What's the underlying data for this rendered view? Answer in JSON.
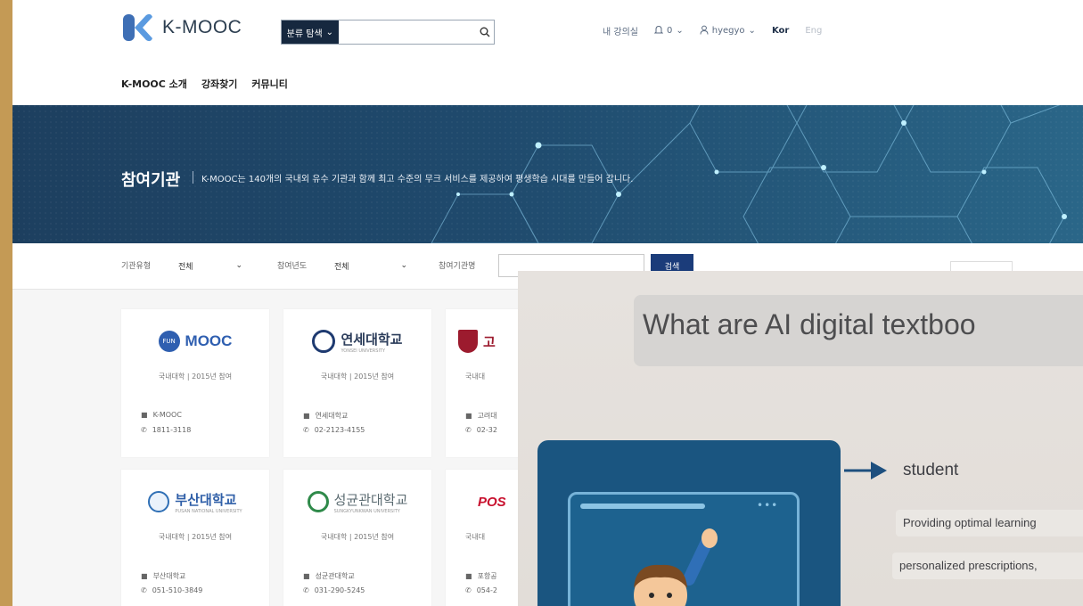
{
  "header": {
    "logo_text": "K-MOOC",
    "search": {
      "category_label": "분류 탐색",
      "placeholder": ""
    },
    "util": {
      "my_lecture": "내 강의실",
      "notifications": "0",
      "username": "hyegyo",
      "lang_kor": "Kor",
      "lang_eng": "Eng"
    }
  },
  "nav": [
    "K-MOOC 소개",
    "강좌찾기",
    "커뮤니티"
  ],
  "banner": {
    "title": "참여기관",
    "description": "K-MOOC는 140개의 국내외 유수 기관과 함께 최고 수준의 무크 서비스를 제공하여 평생학습 시대를 만들어 갑니다."
  },
  "filter": {
    "type_label": "기관유형",
    "type_value": "전체",
    "year_label": "참여년도",
    "year_value": "전체",
    "name_label": "참여기관명",
    "search_button": "검색"
  },
  "cards": [
    {
      "logo": "MOOC",
      "meta": "국내대학 | 2015년 참여",
      "name": "K-MOOC",
      "phone": "1811-3118"
    },
    {
      "logo": "연세대학교",
      "logo_sub": "YONSEI UNIVERSITY",
      "meta": "국내대학 | 2015년 참여",
      "name": "연세대학교",
      "phone": "02-2123-4155"
    },
    {
      "logo": "고",
      "meta": "국내대",
      "name": "고려대",
      "phone": "02-32"
    },
    {
      "logo": "부산대학교",
      "logo_sub": "PUSAN NATIONAL UNIVERSITY",
      "meta": "국내대학 | 2015년 참여",
      "name": "부산대학교",
      "phone": "051-510-3849"
    },
    {
      "logo": "성균관대학교",
      "logo_sub": "SUNGKYUNKWAN UNIVERSITY",
      "meta": "국내대학 | 2015년 참여",
      "name": "성균관대학교",
      "phone": "031-290-5245"
    },
    {
      "logo": "POS",
      "meta": "국내대",
      "name": "포항공",
      "phone": "054-2"
    }
  ],
  "overlay": {
    "title": "What are AI digital textboo",
    "student": "student",
    "line1": "Providing optimal learning",
    "line2": "personalized prescriptions,"
  },
  "colors": {
    "frame": "#c49a55",
    "banner": "#1f4a6d",
    "search_button": "#1b3c7a",
    "logo_blue": "#3f6fbd"
  }
}
